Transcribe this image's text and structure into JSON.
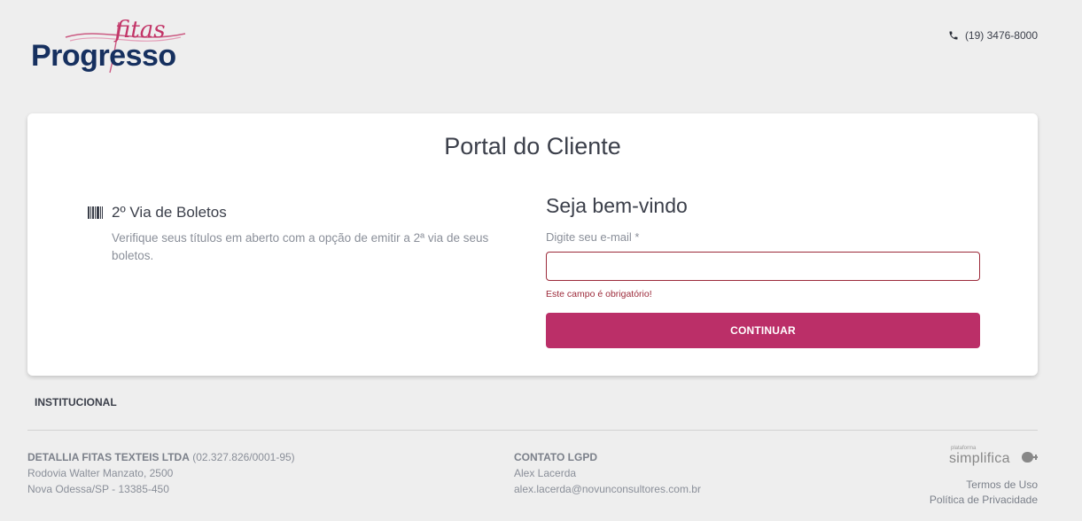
{
  "header": {
    "logo": {
      "brand": "Progresso",
      "script": "fitas"
    },
    "phone": "(19) 3476-8000"
  },
  "card": {
    "title": "Portal do Cliente",
    "feature": {
      "title": "2º Via de Boletos",
      "description": "Verifique seus títulos em aberto com a opção de emitir a 2ª via de seus boletos."
    },
    "login": {
      "welcome": "Seja bem-vindo",
      "email_label": "Digite seu e-mail *",
      "email_value": "",
      "error": "Este campo é obrigatório!",
      "continue_label": "CONTINUAR"
    }
  },
  "footer": {
    "institucional": "INSTITUCIONAL",
    "company": {
      "name": "DETALLIA FITAS TEXTEIS LTDA",
      "cnpj": "(02.327.826/0001-95)",
      "address": "Rodovia Walter Manzato, 2500",
      "city": "Nova Odessa/SP - 13385-450"
    },
    "lgpd": {
      "title": "CONTATO LGPD",
      "name": "Alex Lacerda",
      "email": "alex.lacerda@novunconsultores.com.br"
    },
    "platform": {
      "tag": "plataforma",
      "name": "simplifica"
    },
    "links": {
      "terms": "Termos de Uso",
      "privacy": "Política de Privacidade"
    }
  },
  "colors": {
    "brand_navy": "#16305f",
    "accent": "#bb2f68",
    "error": "#9c2a3a"
  }
}
